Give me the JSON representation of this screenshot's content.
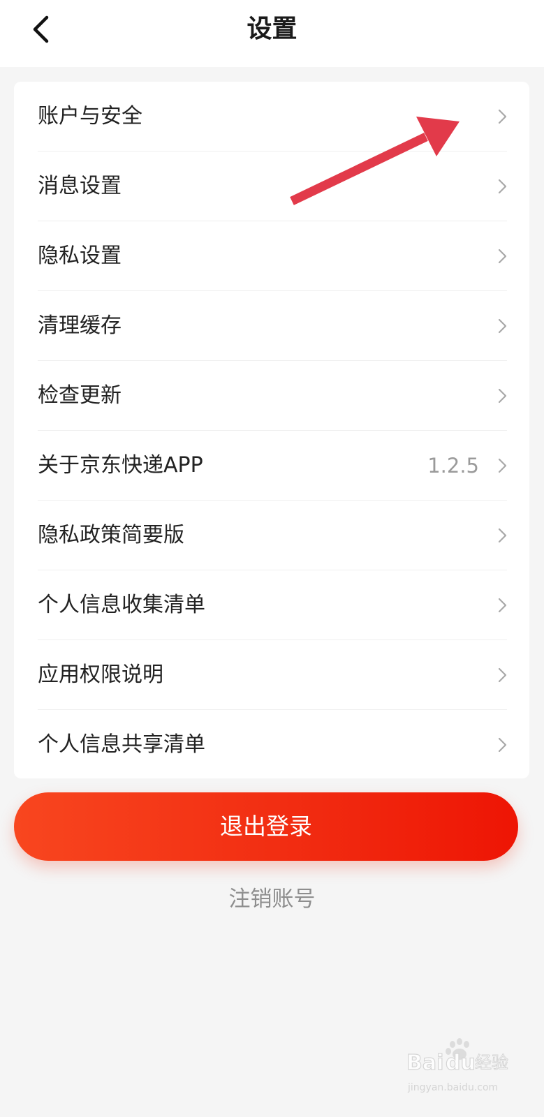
{
  "header": {
    "title": "设置"
  },
  "settings": {
    "items": [
      {
        "label": "账户与安全",
        "value": ""
      },
      {
        "label": "消息设置",
        "value": ""
      },
      {
        "label": "隐私设置",
        "value": ""
      },
      {
        "label": "清理缓存",
        "value": ""
      },
      {
        "label": "检查更新",
        "value": ""
      },
      {
        "label": "关于京东快递APP",
        "value": "1.2.5"
      },
      {
        "label": "隐私政策简要版",
        "value": ""
      },
      {
        "label": "个人信息收集清单",
        "value": ""
      },
      {
        "label": "应用权限说明",
        "value": ""
      },
      {
        "label": "个人信息共享清单",
        "value": ""
      }
    ]
  },
  "actions": {
    "logout_label": "退出登录",
    "deregister_label": "注销账号"
  },
  "icons": {
    "back": "chevron-left-icon",
    "row_arrow": "chevron-right-icon",
    "annotation": "red-arrow-icon"
  },
  "colors": {
    "accent": "#f12a10",
    "annotation_arrow": "#e23a4a",
    "background": "#f5f5f5"
  },
  "watermark": {
    "brand": "Baidu经验",
    "url": "jingyan.baidu.com"
  }
}
